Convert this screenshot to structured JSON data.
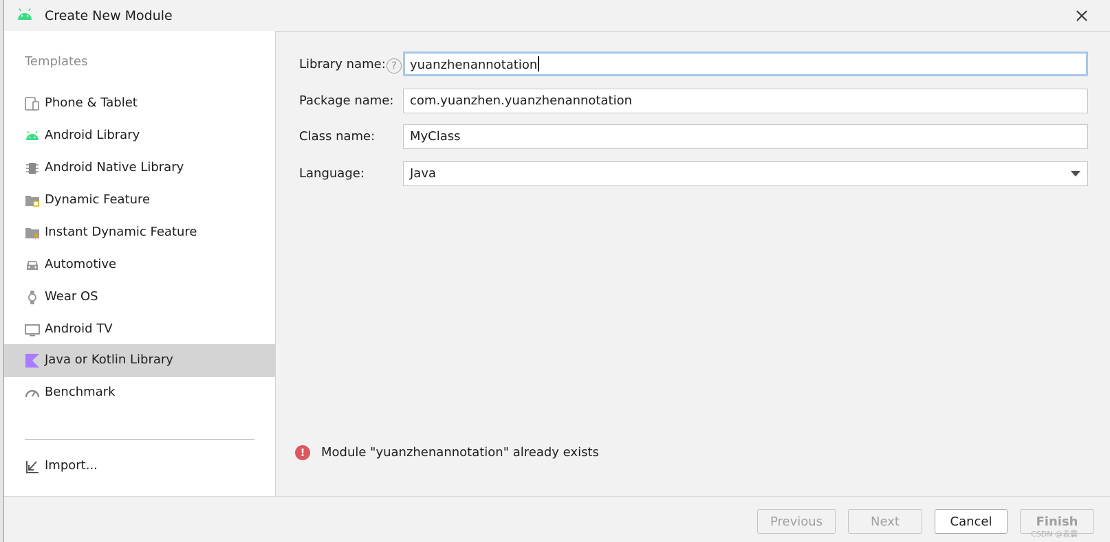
{
  "window": {
    "title": "Create New Module"
  },
  "sidebar": {
    "heading": "Templates",
    "items": [
      {
        "label": "Phone & Tablet",
        "icon": "phone-tablet-icon"
      },
      {
        "label": "Android Library",
        "icon": "android-icon"
      },
      {
        "label": "Android Native Library",
        "icon": "chip-icon"
      },
      {
        "label": "Dynamic Feature",
        "icon": "folder-icon"
      },
      {
        "label": "Instant Dynamic Feature",
        "icon": "folder-lightning-icon"
      },
      {
        "label": "Automotive",
        "icon": "car-icon"
      },
      {
        "label": "Wear OS",
        "icon": "watch-icon"
      },
      {
        "label": "Android TV",
        "icon": "tv-icon"
      },
      {
        "label": "Java or Kotlin Library",
        "icon": "kotlin-icon",
        "selected": true
      },
      {
        "label": "Benchmark",
        "icon": "gauge-icon"
      }
    ],
    "import_label": "Import..."
  },
  "form": {
    "library_name_label": "Library name:",
    "library_name_value": "yuanzhenannotation",
    "help_glyph": "?",
    "package_name_label": "Package name:",
    "package_name_value": "com.yuanzhen.yuanzhenannotation",
    "class_name_label": "Class name:",
    "class_name_value": "MyClass",
    "language_label": "Language:",
    "language_value": "Java"
  },
  "error": {
    "icon_glyph": "!",
    "message": "Module \"yuanzhenannotation\" already exists"
  },
  "footer": {
    "previous_label": "Previous",
    "next_label": "Next",
    "cancel_label": "Cancel",
    "finish_label": "Finish",
    "watermark": "CSDN @袁震"
  },
  "colors": {
    "android_green": "#3ddc84",
    "kotlin_purple": "#a97bff",
    "error_red": "#db5860",
    "focus_blue": "#a7c7ea",
    "selected_bg": "#d4d4d4"
  }
}
